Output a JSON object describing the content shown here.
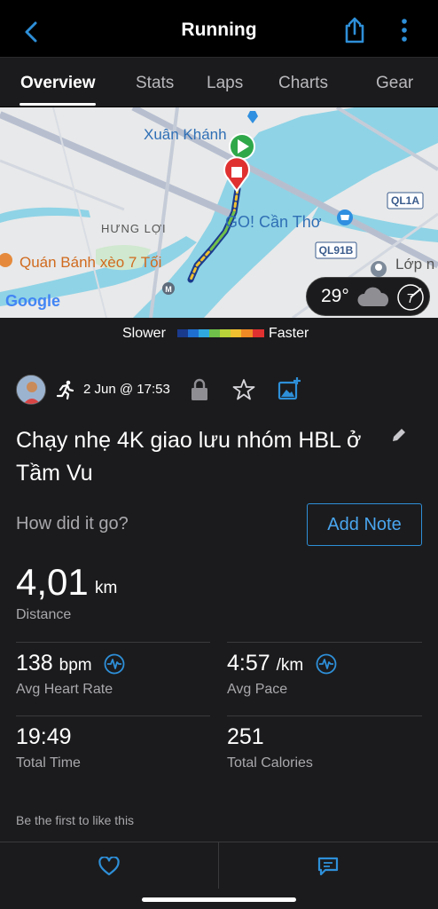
{
  "header": {
    "title": "Running",
    "back_icon": "chevron-left-icon",
    "share_icon": "share-icon",
    "more_icon": "more-vertical-icon",
    "accent_color": "#2e8fd8"
  },
  "tabs": [
    {
      "label": "Overview",
      "active": true
    },
    {
      "label": "Stats",
      "active": false
    },
    {
      "label": "Laps",
      "active": false
    },
    {
      "label": "Charts",
      "active": false
    },
    {
      "label": "Gear",
      "active": false
    }
  ],
  "map": {
    "labels": {
      "xuan_khanh": "Xuân Khánh",
      "hung_loi": "HƯNG LỢI",
      "go_can_tho": "GO! Cần Thơ",
      "quan_banh_xeo": "Quán Bánh xèo 7 Tối",
      "lop": "Lớp n",
      "google": "Google",
      "ql1a": "QL1A",
      "ql91b": "QL91B"
    },
    "weather": {
      "temperature": "29°",
      "wind_value": "7"
    }
  },
  "legend": {
    "slower": "Slower",
    "faster": "Faster"
  },
  "activity": {
    "date": "2 Jun @ 17:53",
    "title": "Chạy nhẹ 4K giao lưu nhóm HBL ở Tầm Vu",
    "how_did_it_go": "How did it go?",
    "add_note": "Add Note"
  },
  "distance": {
    "value": "4,01",
    "unit": "km",
    "label": "Distance"
  },
  "stats": {
    "heart_rate": {
      "value": "138",
      "unit": "bpm",
      "label": "Avg Heart Rate"
    },
    "pace": {
      "value": "4:57",
      "unit": "/km",
      "label": "Avg Pace"
    },
    "time": {
      "value": "19:49",
      "label": "Total Time"
    },
    "calories": {
      "value": "251",
      "label": "Total Calories"
    }
  },
  "social": {
    "likes_text": "Be the first to like this"
  },
  "bottom_bar": {
    "like_icon": "heart-icon",
    "comment_icon": "comment-icon"
  }
}
